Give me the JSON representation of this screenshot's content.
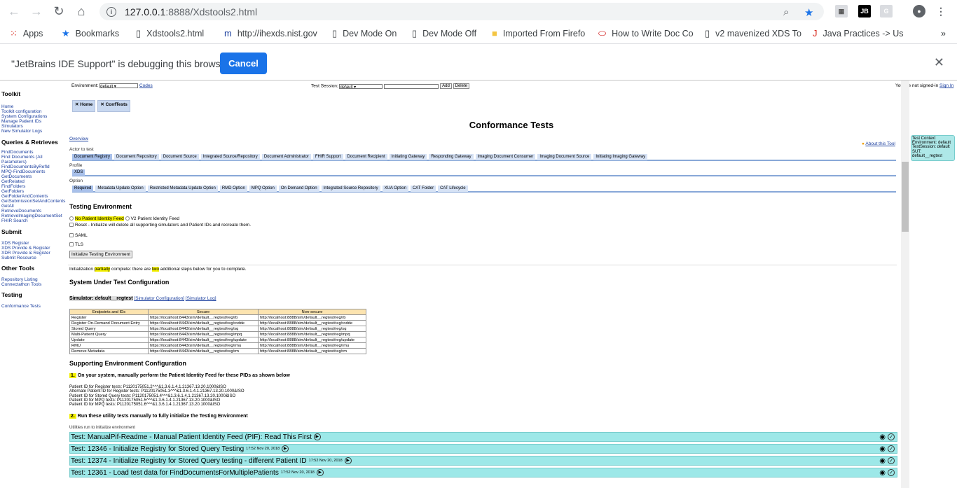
{
  "browser": {
    "url_host": "127.0.0.1",
    "url_rest": ":8888/Xdstools2.html",
    "bookmarks": [
      "Apps",
      "Bookmarks",
      "Xdstools2.html",
      "http://ihexds.nist.gov",
      "Dev Mode On",
      "Dev Mode Off",
      "Imported From Firefo",
      "How to Write Doc Co",
      "v2 mavenized XDS To",
      "Java Practices -> Use"
    ],
    "debug_message": "\"JetBrains IDE Support\" is debugging this browser",
    "cancel_label": "Cancel"
  },
  "sidebar": {
    "toolkit": "Toolkit",
    "toolkit_links": [
      "Home",
      "Toolkit configuration",
      "System Configurations",
      "Manage Patient IDs",
      "Simulators",
      "New Simulator Logs"
    ],
    "queries": "Queries & Retrieves",
    "query_links": [
      "FindDocuments",
      "Find Documents (All",
      "Parameters)",
      "FindDocumentsByRefId",
      "MPQ-FindDocuments",
      "GetDocuments",
      "GetRelated",
      "FindFolders",
      "GetFolders",
      "GetFolderAndContents",
      "GetSubmissionSetAndContents",
      "GetAll",
      "RetrieveDocuments",
      "RetrieveImagingDocumentSet",
      "FHIR Search"
    ],
    "submit": "Submit",
    "submit_links": [
      "XDS Register",
      "XDS Provide & Register",
      "XDR Provide & Register",
      "Submit Resource"
    ],
    "other": "Other Tools",
    "other_links": [
      "Repository Listing",
      "Connectathon Tools"
    ],
    "testing": "Testing",
    "testing_links": [
      "Conformance Tests"
    ]
  },
  "topbar": {
    "environment_label": "Environment:",
    "environment_value": "default",
    "codes": "Codes",
    "test_session_label": "Test Session:",
    "test_session_value": "default",
    "add": "Add",
    "delete": "Delete",
    "signin_text": "You are not signed-in",
    "signin_link": "Sign In"
  },
  "tabs": [
    "Home",
    "ConfTests"
  ],
  "main": {
    "title": "Conformance Tests",
    "overview": "Overview",
    "about": "About this Tool",
    "context": [
      "Test Context",
      "Environment: default",
      "TestSession: default",
      "SUT:",
      "default__regtest"
    ],
    "actor_label": "Actor to test",
    "actors": [
      "Document Registry",
      "Document Repository",
      "Document Source",
      "Integrated Source/Repository",
      "Document Administrator",
      "FHIR Support",
      "Document Recipient",
      "Initiating Gateway",
      "Responding Gateway",
      "Imaging Document Consumer",
      "Imaging Document Source",
      "Initiating Imaging Gateway"
    ],
    "profile_label": "Profile",
    "profiles": [
      "XDS"
    ],
    "option_label": "Option",
    "options": [
      "Required",
      "Metadata Update Option",
      "Restricted Metadata Update Option",
      "RMD Option",
      "MPQ Option",
      "On Demand Option",
      "Integrated Source Repository",
      "XUA Option",
      "CAT Folder",
      "CAT Lifecycle"
    ],
    "testing_env_title": "Testing Environment",
    "no_pif": "No Patient Identity Feed",
    "v2_pif": "V2 Patient Identity Feed",
    "reset_text": "Reset - Initialize will delete all supporting simulators and Patient IDs and recreate them.",
    "saml": "SAML",
    "tls": "TLS",
    "init_button": "Initialize Testing Environment",
    "init_status_a": "Initialization ",
    "init_status_partially": "partially",
    "init_status_b": " complete: there are ",
    "init_status_two": "two",
    "init_status_c": " additional steps below for you to complete.",
    "sut_title": "System Under Test Configuration",
    "simulator": "Simulator: default__regtest",
    "sim_config": "[Simulator Configuration]",
    "sim_log": "[Simulator Log]",
    "table_headers": [
      "Endpoints and IDs",
      "Secure",
      "Non-secure"
    ],
    "table_rows": [
      [
        "Register",
        "https://localhost:8443/sim/default__regtest/reg/rb",
        "http://localhost:8888/sim/default__regtest/reg/rb"
      ],
      [
        "Register On-Demand Document Entry",
        "https://localhost:8443/sim/default__regtest/reg/rodde",
        "http://localhost:8888/sim/default__regtest/reg/rodde"
      ],
      [
        "Stored Query",
        "https://localhost:8443/sim/default__regtest/reg/sq",
        "http://localhost:8888/sim/default__regtest/reg/sq"
      ],
      [
        "Multi-Patient Query",
        "https://localhost:8443/sim/default__regtest/reg/mpq",
        "http://localhost:8888/sim/default__regtest/reg/mpq"
      ],
      [
        "Update",
        "https://localhost:8443/sim/default__regtest/reg/update",
        "http://localhost:8888/sim/default__regtest/reg/update"
      ],
      [
        "RMU",
        "https://localhost:8443/sim/default__regtest/reg/rmu",
        "http://localhost:8888/sim/default__regtest/reg/rmu"
      ],
      [
        "Remove Metadata",
        "https://localhost:8443/sim/default__regtest/reg/rm",
        "http://localhost:8888/sim/default__regtest/reg/rm"
      ]
    ],
    "support_title": "Supporting Environment Configuration",
    "step1_num": "1.",
    "step1_text": "On your system, manually perform the Patient Identity Feed for these PIDs as shown below",
    "pids": [
      "Patient ID for Register tests: P1120175051.2^^^&1.3.6.1.4.1.21367.13.20.1000&ISO",
      "Alternate Patient ID for Register tests: P1120175051.3^^^&1.3.6.1.4.1.21367.13.20.1000&ISO",
      "Patient ID for Stored Query tests: P1120175051.4^^^&1.3.6.1.4.1.21367.13.20.1000&ISO",
      "Patient ID for MPQ tests: P1120175051.5^^^&1.3.6.1.4.1.21367.13.20.1000&ISO",
      "Patient ID for MPQ tests: P1120175051.6^^^&1.3.6.1.4.1.21367.13.20.1000&ISO"
    ],
    "step2_num": "2.",
    "step2_text": "Run these utility tests manually to fully initialize the Testing Environment",
    "utilities_label": "Utilities run to initialize environment",
    "tests": [
      {
        "name": "Test: ManualPif-Readme - Manual Patient Identity Feed (PIF): Read This First",
        "date": ""
      },
      {
        "name": "Test: 12346 - Initialize Registry for Stored Query Testing",
        "date": "17:52 Nov 20, 2018"
      },
      {
        "name": "Test: 12374 - Initialize Registry for Stored Query testing - different Patient ID",
        "date": "17:52 Nov 20, 2018"
      },
      {
        "name": "Test: 12361 - Load test data for FindDocumentsForMultiplePatients",
        "date": "17:52 Nov 20, 2018"
      }
    ]
  }
}
